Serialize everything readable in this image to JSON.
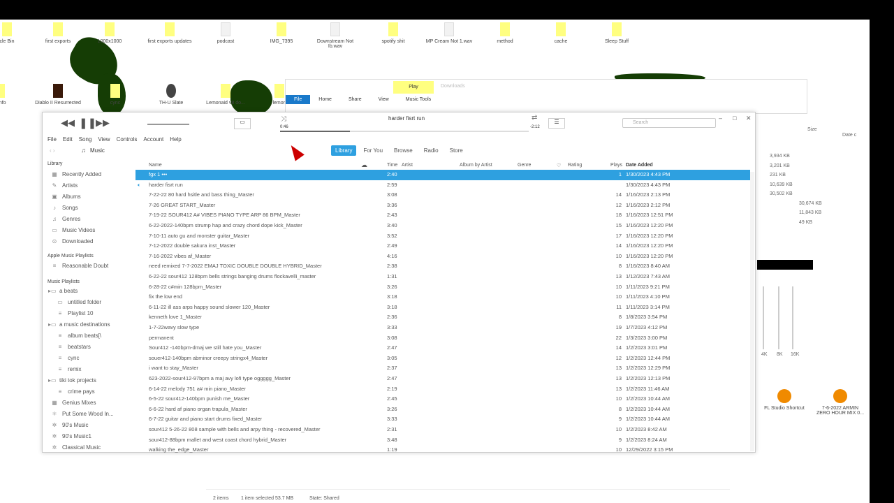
{
  "desktop": {
    "top_icons": [
      "cle Bin",
      "first exports",
      "1000x1000",
      "first exports updates",
      "podcast",
      "IMG_7395",
      "Downstream Not Ib.wav",
      "spotify shit",
      "MP Cream Not 1.wav",
      "method",
      "cache",
      "Sleep Stuff"
    ],
    "row2_icons": [
      "o info",
      "Diablo II Resurrected",
      "cync",
      "TH-U Slate",
      "Lemonaid v8 do...",
      "lemon"
    ],
    "right_icons": [
      "FL Studio Shortcut",
      "7-6-2022 ARMIN ZERO HOUR MIX 0..."
    ]
  },
  "explorer": {
    "play_tab": "Play",
    "title": "Downloads",
    "tabs": [
      "File",
      "Home",
      "Share",
      "View",
      "Music Tools"
    ],
    "status": {
      "items": "2 items",
      "selected": "1 item selected  53.7 MB",
      "state": "State: Shared"
    }
  },
  "right_explorer": {
    "headers": [
      "Size",
      "Date c"
    ],
    "sizes": [
      "3,934 KB",
      "3,201 KB",
      "231 KB",
      "10,639 KB",
      "30,502 KB",
      "30,674 KB",
      "11,843 KB",
      "49 KB"
    ],
    "eq": [
      "4K",
      "8K",
      "16K"
    ]
  },
  "itunes": {
    "now_playing": "harder fisrt run",
    "elapsed": "0:46",
    "remaining": "-2:12",
    "progress": 0.28,
    "search_placeholder": "Search",
    "menu": [
      "File",
      "Edit",
      "Song",
      "View",
      "Controls",
      "Account",
      "Help"
    ],
    "source": "Music",
    "nav_tabs": [
      "Library",
      "For You",
      "Browse",
      "Radio",
      "Store"
    ],
    "sidebar": {
      "library_header": "Library",
      "library": [
        "Recently Added",
        "Artists",
        "Albums",
        "Songs",
        "Genres",
        "Music Videos",
        "Downloaded"
      ],
      "apple_header": "Apple Music Playlists",
      "apple": [
        "Reasonable Doubt"
      ],
      "playlists_header": "Music Playlists",
      "playlists": [
        "a beats",
        "untitled folder",
        "Playlist 10",
        "a music destinations",
        "album beats[\\",
        "beatstars",
        "cync",
        "remix",
        "tiki tok projects",
        "crime pays",
        "Genius Mixes",
        "Put Some Wood In...",
        "90's Music",
        "90's Music1",
        "Classical Music"
      ]
    },
    "columns": {
      "name": "Name",
      "time": "Time",
      "artist": "Artist",
      "album": "Album by Artist",
      "genre": "Genre",
      "rating": "Rating",
      "plays": "Plays",
      "date": "Date Added"
    },
    "songs": [
      [
        "fgx 1 •••",
        "2:40",
        "1",
        "1/30/2023 4:43 PM"
      ],
      [
        "harder fisrt run",
        "2:59",
        "",
        "1/30/2023 4:43 PM"
      ],
      [
        "7-22-22 80 hard hsitle and bass thing_Master",
        "3:08",
        "14",
        "1/16/2023 2:13 PM"
      ],
      [
        "7-26 GREAT START_Master",
        "3:36",
        "12",
        "1/16/2023 2:12 PM"
      ],
      [
        "7-19-22 SOUR412 A# VIBES PIANO TYPE ARP 86 BPM_Master",
        "2:43",
        "18",
        "1/16/2023 12:51 PM"
      ],
      [
        "6-22-2022-140bpm strump hap and crazy chord dope kick_Master",
        "3:40",
        "15",
        "1/16/2023 12:20 PM"
      ],
      [
        "7-10-11 auto gu and monster guitar_Master",
        "3:52",
        "17",
        "1/16/2023 12:20 PM"
      ],
      [
        "7-12-2022 double sakura inst_Master",
        "2:49",
        "14",
        "1/16/2023 12:20 PM"
      ],
      [
        "7-16-2022 vibes af_Master",
        "4:16",
        "10",
        "1/16/2023 12:20 PM"
      ],
      [
        " need remixed  7-7-2022 EMAJ TOXIC DOUBLE DOUBLE HYBRID_Master",
        "2:38",
        "8",
        "1/16/2023 8:40 AM"
      ],
      [
        "6-22-22 sour412 128bpm bells strings banging drums flockavelli_master",
        "1:31",
        "13",
        "1/12/2023 7:43 AM"
      ],
      [
        "6-28-22 c#min 128bpm_Master",
        "3:26",
        "10",
        "1/11/2023 9:21 PM"
      ],
      [
        "fix the low end",
        "3:18",
        "10",
        "1/11/2023 4:10 PM"
      ],
      [
        "6-11-22 ill ass arps happy sound slower 120_Master",
        "3:18",
        "11",
        "1/11/2023 3:14 PM"
      ],
      [
        "kenneth love 1_Master",
        "2:36",
        "8",
        "1/8/2023 3:54 PM"
      ],
      [
        "1-7-22wavy slow type",
        "3:33",
        "19",
        "1/7/2023 4:12 PM"
      ],
      [
        "permanent",
        "3:08",
        "22",
        "1/3/2023 3:00 PM"
      ],
      [
        "Sour412 -140bpm-dmaj we still hate you_Master",
        "2:47",
        "14",
        "1/2/2023 3:01 PM"
      ],
      [
        "souer412-140bpm abminor creepy stringx4_Master",
        "3:05",
        "12",
        "1/2/2023 12:44 PM"
      ],
      [
        "i want to stay_Master",
        "2:37",
        "13",
        "1/2/2023 12:29 PM"
      ],
      [
        "623-2022-sour412-97bpm a maj avy lofi type oggggg_Master",
        "2:47",
        "13",
        "1/2/2023 12:13 PM"
      ],
      [
        "6-14-22 melody 751 a# min piano_Master",
        "2:19",
        "13",
        "1/2/2023 11:46 AM"
      ],
      [
        "6-5-22 sour412-140bpm punish me_Master",
        "2:45",
        "10",
        "1/2/2023 10:44 AM"
      ],
      [
        "6-6-22 hard af piano organ trapula_Master",
        "3:26",
        "8",
        "1/2/2023 10:44 AM"
      ],
      [
        "6-7-22  guitar and piano start drums fixed_Master",
        "3:33",
        "9",
        "1/2/2023 10:44 AM"
      ],
      [
        "sour412 5-26-22 808 sample with bells and arpy thing - recovered_Master",
        "2:31",
        "10",
        "1/2/2023 8:42 AM"
      ],
      [
        "sour412-88bpm mallet and west coast chord hybrid_Master",
        "3:48",
        "9",
        "1/2/2023 8:24 AM"
      ],
      [
        "walking the_edge_Master",
        "1:19",
        "10",
        "12/29/2022 3:15 PM"
      ]
    ]
  },
  "colors": {
    "accent": "#2ea0e0",
    "explorer_file": "#1979ca",
    "highlight": "#ffff80",
    "blob": "#153d05"
  }
}
